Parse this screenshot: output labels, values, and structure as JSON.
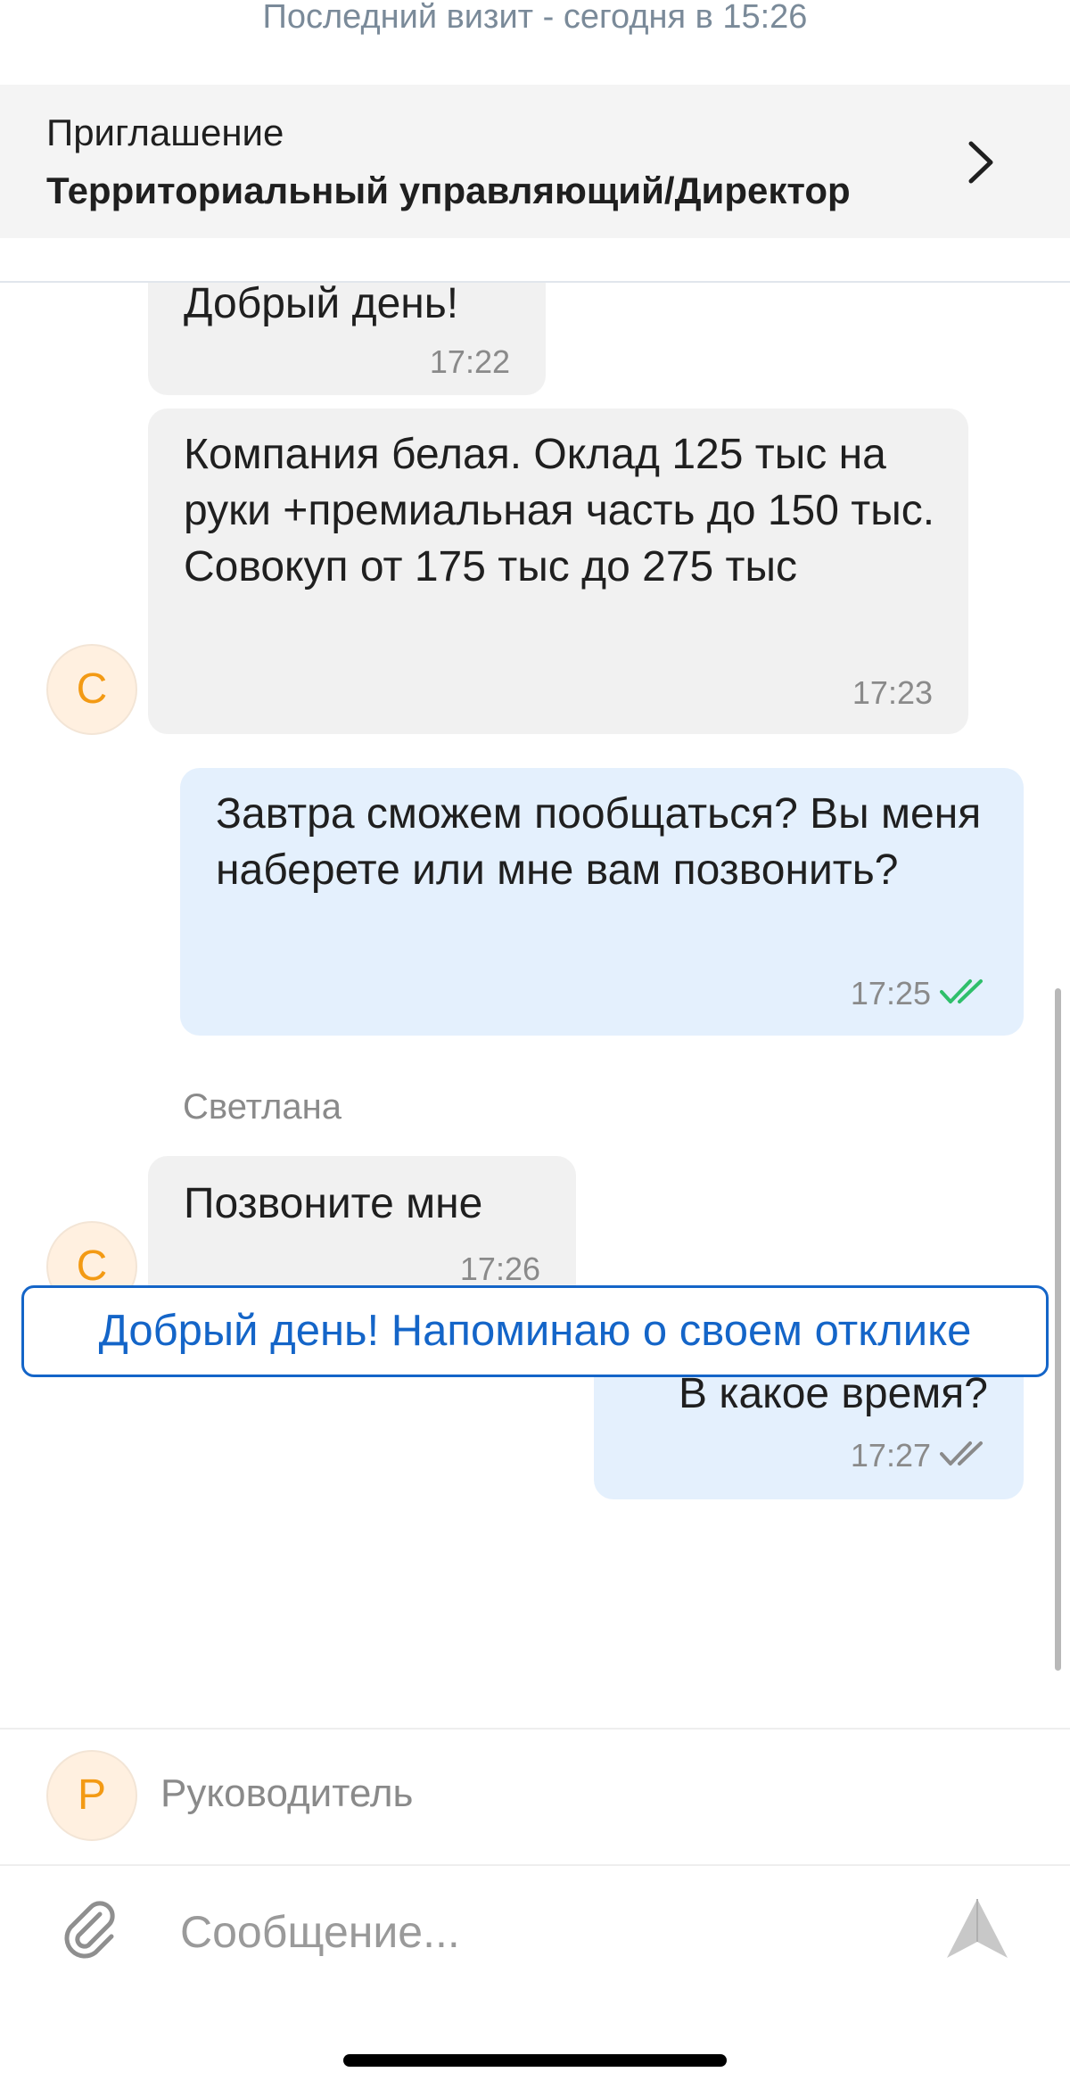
{
  "header": {
    "last_visit": "Последний визит - сегодня в 15:26"
  },
  "invitation": {
    "label": "Приглашение",
    "title": "Территориальный управляющий/Директор"
  },
  "messages": [
    {
      "direction": "in",
      "text": "Добрый день!",
      "time": "17:22"
    },
    {
      "direction": "in",
      "text": "Компания белая. Оклад 125 тыс на руки +премиальная часть до 150 тыс. Совокуп от 175 тыс до 275 тыс",
      "time": "17:23",
      "avatar_letter": "С"
    },
    {
      "direction": "out",
      "text": "Завтра сможем пообщаться? Вы меня наберете или мне вам позвонить?",
      "time": "17:25",
      "status": "read"
    },
    {
      "direction": "in",
      "sender": "Светлана",
      "text": "Позвоните мне",
      "time": "17:26",
      "avatar_letter": "С"
    },
    {
      "direction": "out",
      "text": "В какое время?",
      "time": "17:27",
      "status": "delivered"
    }
  ],
  "quick_reply": {
    "text": "Добрый день! Напоминаю о своем отклике"
  },
  "role": {
    "avatar_letter": "Р",
    "name": "Руководитель"
  },
  "composer": {
    "placeholder": "Сообщение..."
  },
  "colors": {
    "accent": "#1465c8",
    "incoming_bubble": "#f1f1f1",
    "outgoing_bubble": "#e4f0fd",
    "read_check": "#2fbf6b",
    "avatar_letter": "#f39a14"
  },
  "icons": {
    "chevron": "chevron-right-icon",
    "read": "double-check-icon",
    "attach": "paperclip-icon",
    "send": "send-icon"
  }
}
